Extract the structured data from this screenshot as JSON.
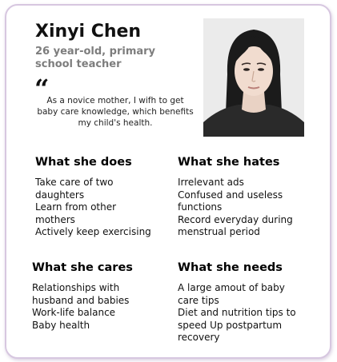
{
  "persona": {
    "name": "Xinyi Chen",
    "subtitle": "26 year-old,  primary school teacher",
    "quote_mark": "“",
    "quote": "As a novice mother, I wifh to get baby care knowledge, which benefits my child's health."
  },
  "sections": {
    "does": {
      "title": "What she does",
      "items": [
        "Take care of two daughters",
        "Learn from other mothers",
        "Actively keep exercising"
      ]
    },
    "hates": {
      "title": "What she hates",
      "items": [
        "Irrelevant ads",
        "Confused and useless functions",
        "Record everyday during menstrual period"
      ]
    },
    "cares": {
      "title": "What she cares",
      "items": [
        "Relationships with husband and babies",
        "Work-life balance",
        "Baby health"
      ]
    },
    "needs": {
      "title": "What she needs",
      "items": [
        "A large amout of baby care tips",
        "Diet and nutrition tips to speed Up postpartum recovery"
      ]
    }
  },
  "colors": {
    "card_border": "#d7c7e0",
    "subtitle_gray": "#7d7d7d"
  }
}
